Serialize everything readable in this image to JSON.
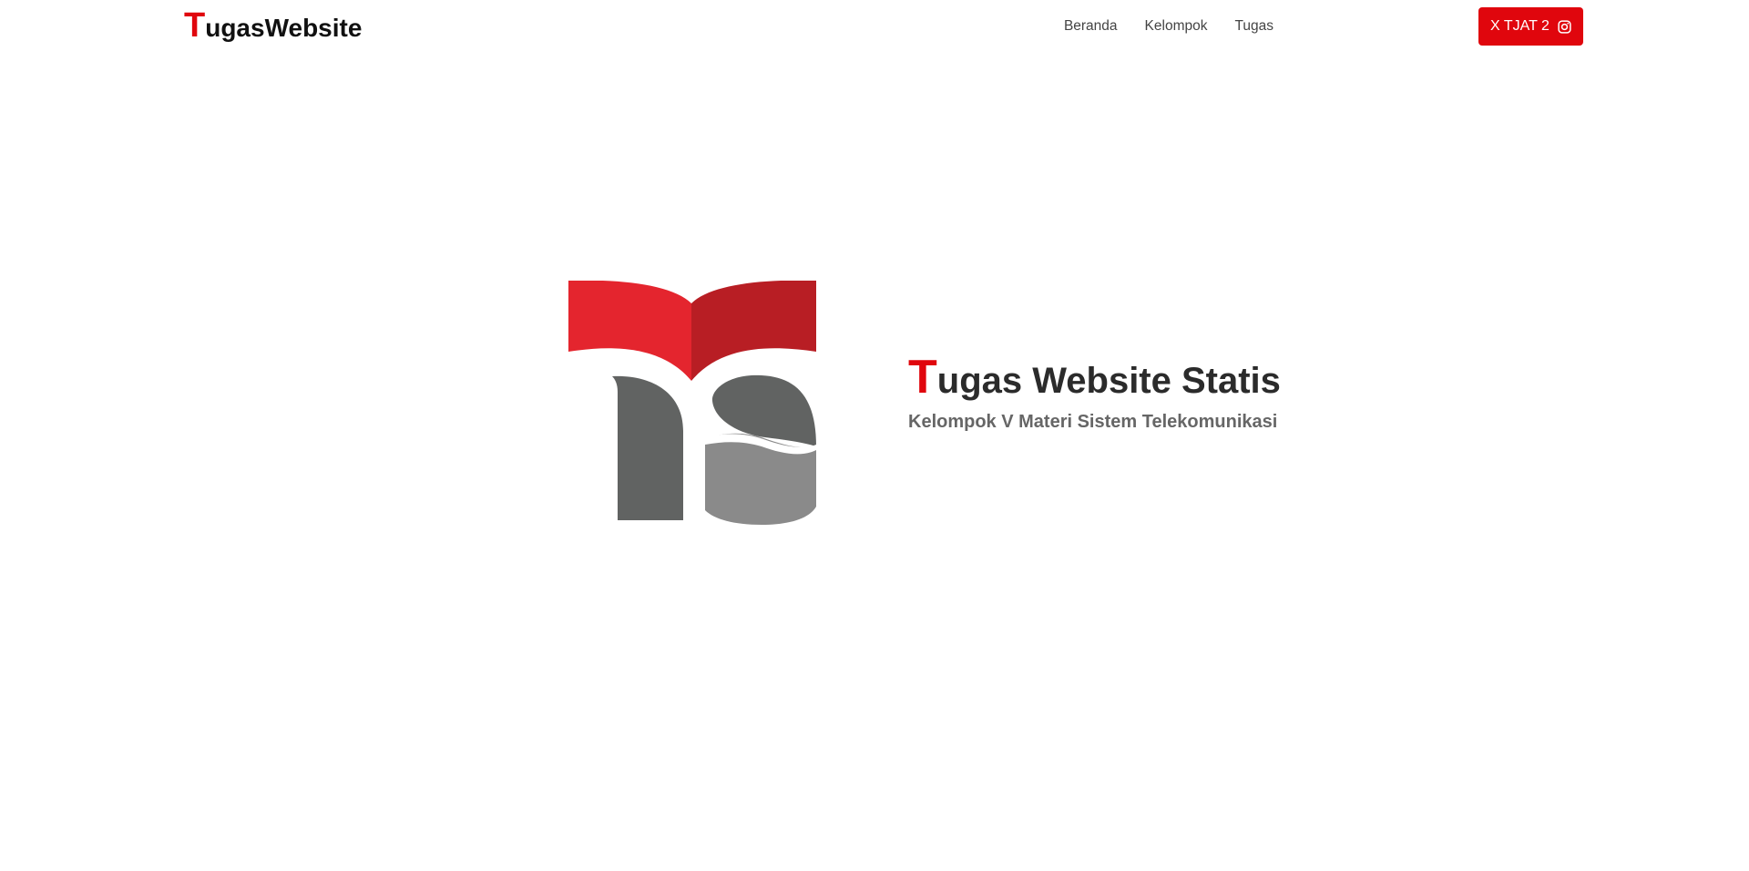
{
  "navbar": {
    "brand": {
      "first_letter": "T",
      "rest": "ugasWebsite"
    },
    "links": [
      {
        "label": "Beranda"
      },
      {
        "label": "Kelompok"
      },
      {
        "label": "Tugas"
      }
    ],
    "cta": {
      "label": "X TJAT 2",
      "icon": "instagram-icon"
    }
  },
  "hero": {
    "logo": "ts-logo",
    "title": {
      "first_letter": "T",
      "rest": "ugas Website Statis"
    },
    "subtitle": "Kelompok V Materi Sistem Telekomunikasi"
  },
  "colors": {
    "accent": "#e0060d",
    "logo_red_left": "#e4252e",
    "logo_red_right": "#b81e24",
    "logo_gray_dark": "#616362",
    "logo_gray_light": "#8a8a8a",
    "title_text": "#2b2b2b",
    "subtitle_text": "#666666"
  }
}
